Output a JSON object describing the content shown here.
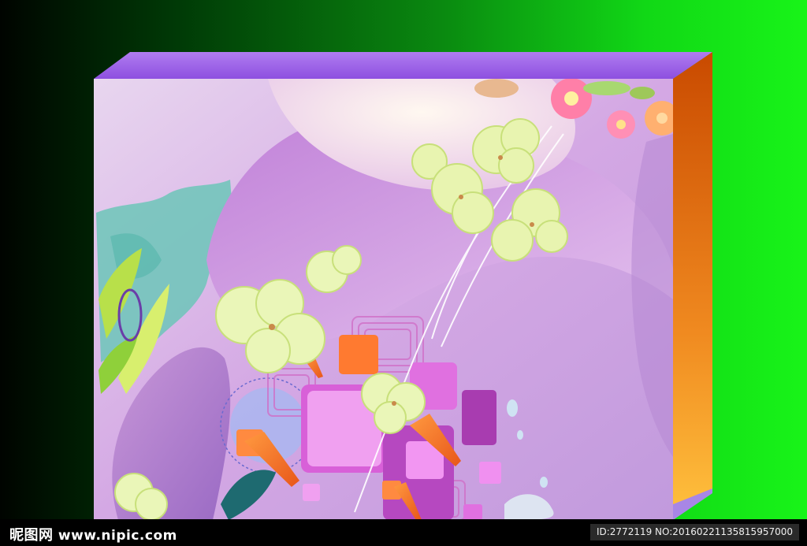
{
  "watermark": {
    "brand": "昵图网",
    "site": "www.nipic.com",
    "id_line": "ID:2772119 NO:20160221135815957000"
  },
  "colors": {
    "background_left": "#000400",
    "background_right": "#18f418",
    "box_top": "#9a5ee8",
    "box_side_top": "#cc4d00",
    "box_side_bottom": "#ffbf3a",
    "front_panel": "#cfa9e0",
    "footer": "#000000"
  },
  "icons": [
    "clover-leaf-icon",
    "flower-icon",
    "square-tile-icon",
    "carrot-icon"
  ]
}
